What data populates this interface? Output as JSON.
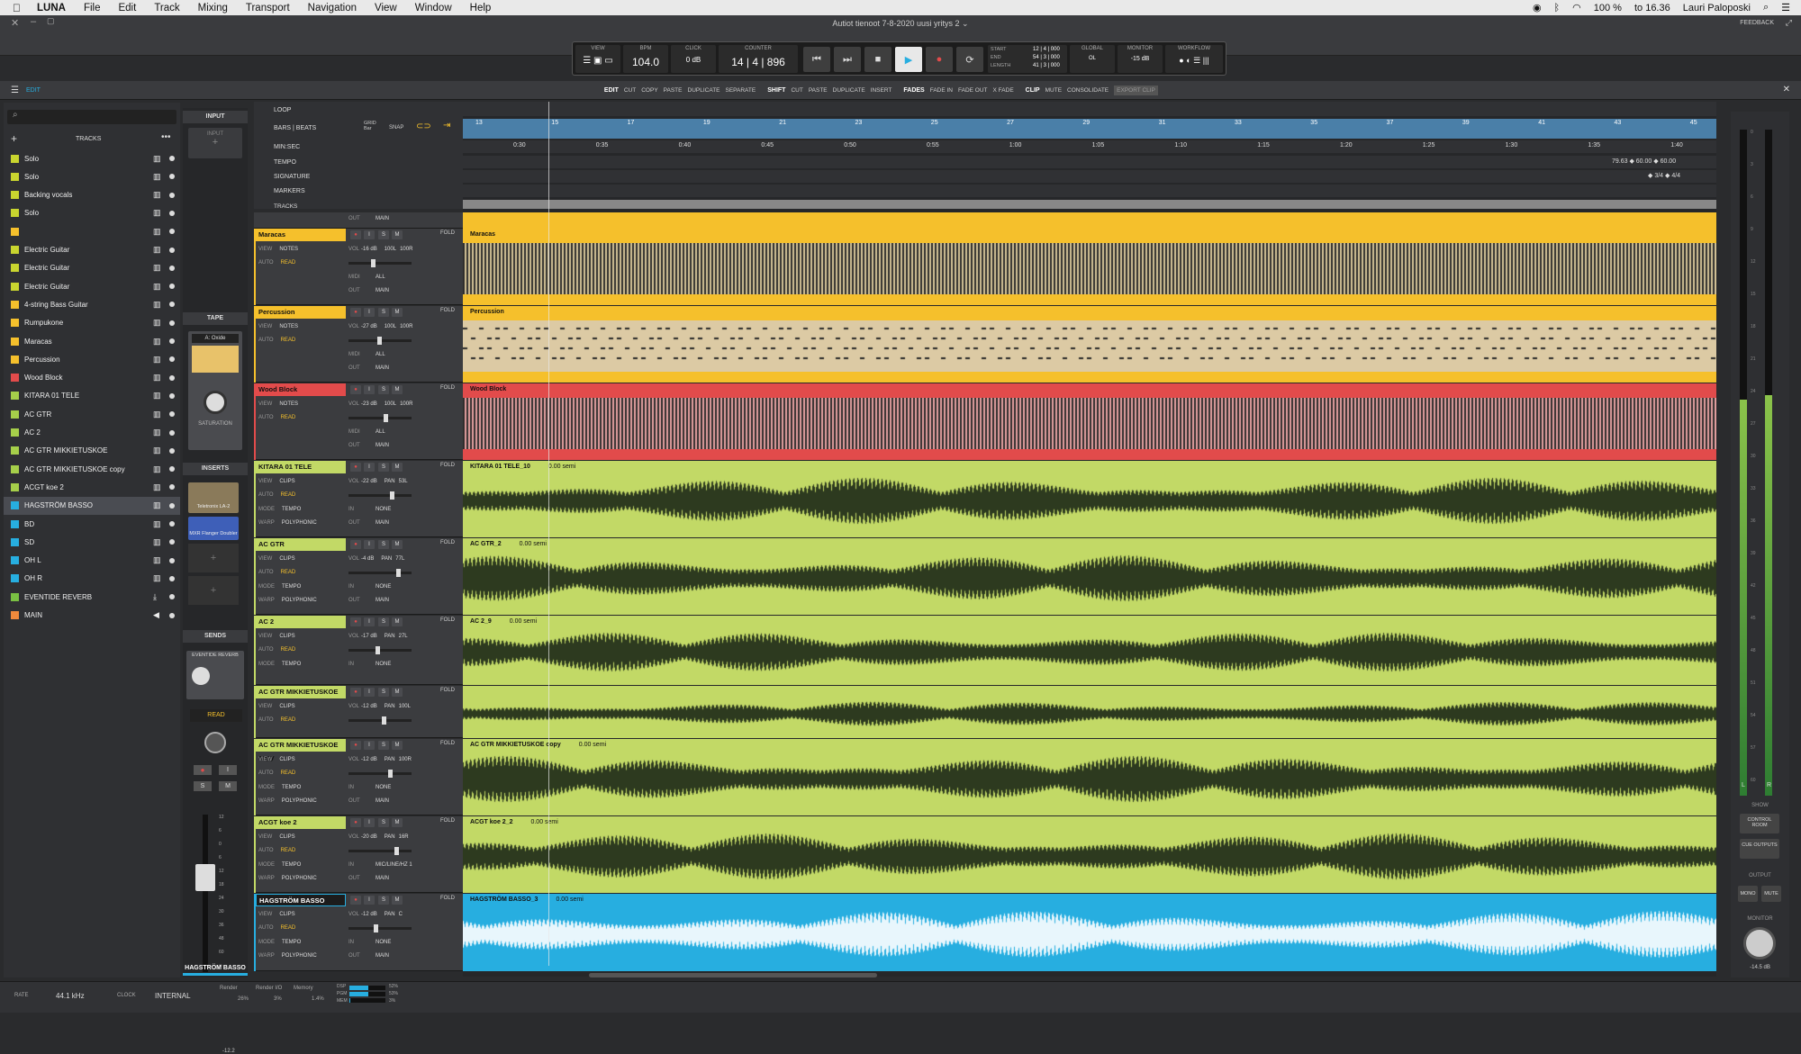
{
  "menubar": {
    "app": "LUNA",
    "items": [
      "File",
      "Edit",
      "Track",
      "Mixing",
      "Transport",
      "Navigation",
      "View",
      "Window",
      "Help"
    ],
    "battery": "100 %",
    "clock": "to 16.36",
    "user": "Lauri Paloposki"
  },
  "window": {
    "title": "Autiot tienoot 7-8-2020 uusi yritys 2",
    "feedback": "FEEDBACK",
    "edit_tab": "EDIT"
  },
  "transport": {
    "view_label": "VIEW",
    "bpm_label": "BPM",
    "bpm": "104.0",
    "click_label": "CLICK",
    "click_value": "0 dB",
    "counter_label": "COUNTER",
    "counter": "14 | 4 | 896",
    "start_label": "START",
    "end_label": "END",
    "length_label": "LENGTH",
    "start": "12 | 4 | 000",
    "end": "54 | 3 | 000",
    "length": "41 | 3 | 000",
    "global_label": "GLOBAL",
    "monitor_label": "MONITOR",
    "monitor_value": "-15 dB",
    "workflow_label": "WORKFLOW",
    "ol": "OL"
  },
  "toolbar": {
    "edit": "EDIT",
    "cut": "CUT",
    "copy": "COPY",
    "paste": "PASTE",
    "duplicate": "DUPLICATE",
    "separate": "SEPARATE",
    "shift": "SHIFT",
    "shift_cut": "CUT",
    "shift_paste": "PASTE",
    "shift_duplicate": "DUPLICATE",
    "insert": "INSERT",
    "fades": "FADES",
    "fade_in": "FADE IN",
    "fade_out": "FADE OUT",
    "x_fade": "X FADE",
    "clip": "CLIP",
    "mute": "MUTE",
    "consolidate": "CONSOLIDATE",
    "export_clip": "EXPORT CLIP"
  },
  "tracks_panel": {
    "title": "TRACKS",
    "items": [
      {
        "name": "Solo",
        "color": "#c9d52f",
        "icon": "piano-icon"
      },
      {
        "name": "Solo",
        "color": "#c9d52f",
        "icon": "piano-icon"
      },
      {
        "name": "Backing vocals",
        "color": "#c9d52f",
        "icon": "piano-icon"
      },
      {
        "name": "Solo",
        "color": "#c9d52f",
        "icon": "piano-icon"
      },
      {
        "name": "",
        "color": "#f5c02c",
        "icon": "piano-icon"
      },
      {
        "name": "Electric Guitar",
        "color": "#c9d52f",
        "icon": "piano-icon"
      },
      {
        "name": "Electric Guitar",
        "color": "#c9d52f",
        "icon": "piano-icon"
      },
      {
        "name": "Electric Guitar",
        "color": "#c9d52f",
        "icon": "piano-icon"
      },
      {
        "name": "4-string Bass Guitar",
        "color": "#f5c02c",
        "icon": "piano-icon"
      },
      {
        "name": "Rumpukone",
        "color": "#f5c02c",
        "icon": "piano-icon"
      },
      {
        "name": "Maracas",
        "color": "#f5c02c",
        "icon": "piano-icon"
      },
      {
        "name": "Percussion",
        "color": "#f5c02c",
        "icon": "piano-icon"
      },
      {
        "name": "Wood Block",
        "color": "#e24b4b",
        "icon": "piano-icon"
      },
      {
        "name": "KITARA 01 TELE",
        "color": "#a6cf4a",
        "icon": "waveform-icon"
      },
      {
        "name": "AC GTR",
        "color": "#a6cf4a",
        "icon": "waveform-icon"
      },
      {
        "name": "AC 2",
        "color": "#a6cf4a",
        "icon": "waveform-icon"
      },
      {
        "name": "AC GTR MIKKIETUSKOE",
        "color": "#a6cf4a",
        "icon": "waveform-icon"
      },
      {
        "name": "AC GTR MIKKIETUSKOE copy",
        "color": "#a6cf4a",
        "icon": "waveform-icon"
      },
      {
        "name": "ACGT koe 2",
        "color": "#a6cf4a",
        "icon": "waveform-icon"
      },
      {
        "name": "HAGSTRÖM BASSO",
        "color": "#27aee0",
        "icon": "waveform-icon"
      },
      {
        "name": "BD",
        "color": "#27aee0",
        "icon": "waveform-icon"
      },
      {
        "name": "SD",
        "color": "#27aee0",
        "icon": "waveform-icon"
      },
      {
        "name": "OH L",
        "color": "#27aee0",
        "icon": "waveform-icon"
      },
      {
        "name": "OH R",
        "color": "#27aee0",
        "icon": "waveform-icon"
      },
      {
        "name": "EVENTIDE REVERB",
        "color": "#7ac043",
        "icon": "bus-icon"
      },
      {
        "name": "MAIN",
        "color": "#f08a3c",
        "icon": "speaker-icon"
      }
    ]
  },
  "strip": {
    "input": "INPUT",
    "input_btn": "INPUT",
    "tape": "TAPE",
    "tape_type": "A: Oxide",
    "saturation": "SATURATION",
    "inserts": "INSERTS",
    "insert1": "Teletronix LA-2",
    "insert2": "MXR Flanger Doubler",
    "sends": "SENDS",
    "send1": "EVENTIDE REVERB",
    "read": "READ",
    "track_name": "HAGSTRÖM BASSO",
    "fader_val": "-12.2",
    "fader_scale": [
      "12",
      "6",
      "0",
      "6",
      "12",
      "18",
      "24",
      "30",
      "36",
      "48",
      "60",
      "∞"
    ]
  },
  "rulers": {
    "loop": "LOOP",
    "bars_beats": "BARS | BEATS",
    "grid": "GRID",
    "grid_val": "Bar",
    "snap": "SNAP",
    "minsec": "MIN:SEC",
    "tempo": "TEMPO",
    "signature": "SIGNATURE",
    "markers": "MARKERS",
    "tracks": "TRACKS",
    "bars": [
      "13",
      "15",
      "17",
      "19",
      "21",
      "23",
      "25",
      "27",
      "29",
      "31",
      "33",
      "35",
      "37",
      "39",
      "41",
      "43",
      "45"
    ],
    "times": [
      "0:30",
      "0:35",
      "0:40",
      "0:45",
      "0:50",
      "0:55",
      "1:00",
      "1:05",
      "1:10",
      "1:15",
      "1:20",
      "1:25",
      "1:30",
      "1:35",
      "1:40"
    ],
    "tempo_vals": "79.63 ◆ 60.00 ◆ 60.00",
    "sig_vals": "◆ 3/4  ◆ 4/4"
  },
  "track_headers": [
    {
      "name": "Maracas",
      "color": "#f5c02c",
      "view": "NOTES",
      "auto": "READ",
      "vol": "-16 dB",
      "pan": "100L",
      "pan2": "100R",
      "rows": [
        [
          "MIDI",
          "ALL"
        ],
        [
          "OUT",
          "MAIN"
        ]
      ],
      "clip": "Maracas",
      "type": "midi",
      "h": 85
    },
    {
      "name": "Percussion",
      "color": "#f5c02c",
      "view": "NOTES",
      "auto": "READ",
      "vol": "-27 dB",
      "pan": "100L",
      "pan2": "100R",
      "rows": [
        [
          "MIDI",
          "ALL"
        ],
        [
          "OUT",
          "MAIN"
        ]
      ],
      "clip": "Percussion",
      "type": "midi2",
      "h": 85
    },
    {
      "name": "Wood Block",
      "color": "#e24b4b",
      "view": "NOTES",
      "auto": "READ",
      "vol": "-23 dB",
      "pan": "100L",
      "pan2": "100R",
      "rows": [
        [
          "MIDI",
          "ALL"
        ],
        [
          "OUT",
          "MAIN"
        ]
      ],
      "clip": "Wood Block",
      "type": "midi",
      "h": 85
    },
    {
      "name": "KITARA 01 TELE",
      "color": "#c2d966",
      "view": "CLIPS",
      "auto": "READ",
      "vol": "-22 dB",
      "pan": "PAN",
      "pan2": "53L",
      "rows": [
        [
          "MODE",
          "TEMPO",
          "IN",
          "NONE"
        ],
        [
          "WARP",
          "POLYPHONIC",
          "OUT",
          "MAIN"
        ]
      ],
      "clip": "KITARA 01 TELE_10",
      "semi": "0.00 semi",
      "type": "audio",
      "h": 85
    },
    {
      "name": "AC GTR",
      "color": "#c2d966",
      "view": "CLIPS",
      "auto": "READ",
      "vol": "-4 dB",
      "pan": "PAN",
      "pan2": "77L",
      "rows": [
        [
          "MODE",
          "TEMPO",
          "IN",
          "NONE"
        ],
        [
          "WARP",
          "POLYPHONIC",
          "OUT",
          "MAIN"
        ]
      ],
      "clip": "AC GTR_2",
      "semi": "0.00 semi",
      "type": "audio",
      "h": 85
    },
    {
      "name": "AC 2",
      "color": "#c2d966",
      "view": "CLIPS",
      "auto": "READ",
      "vol": "-17 dB",
      "pan": "PAN",
      "pan2": "27L",
      "rows": [
        [
          "MODE",
          "TEMPO",
          "IN",
          "NONE"
        ]
      ],
      "clip": "AC 2_9",
      "semi": "0.00 semi",
      "type": "audio",
      "h": 77
    },
    {
      "name": "AC GTR MIKKIETUSKOE",
      "color": "#c2d966",
      "view": "CLIPS",
      "auto": "READ",
      "vol": "-12 dB",
      "pan": "PAN",
      "pan2": "100L",
      "rows": [],
      "clip": "",
      "semi": "",
      "type": "audio",
      "h": 58
    },
    {
      "name": "AC GTR MIKKIETUSKOE copy",
      "color": "#c2d966",
      "view": "CLIPS",
      "auto": "READ",
      "vol": "-12 dB",
      "pan": "PAN",
      "pan2": "100R",
      "rows": [
        [
          "MODE",
          "TEMPO",
          "IN",
          "NONE"
        ],
        [
          "WARP",
          "POLYPHONIC",
          "OUT",
          "MAIN"
        ]
      ],
      "clip": "AC GTR MIKKIETUSKOE copy",
      "semi": "0.00 semi",
      "type": "audio",
      "h": 85
    },
    {
      "name": "ACGT koe 2",
      "color": "#c2d966",
      "view": "CLIPS",
      "auto": "READ",
      "vol": "-20 dB",
      "pan": "PAN",
      "pan2": "16R",
      "rows": [
        [
          "MODE",
          "TEMPO",
          "IN",
          "MIC/LINE/HZ 1"
        ],
        [
          "WARP",
          "POLYPHONIC",
          "OUT",
          "MAIN"
        ]
      ],
      "clip": "ACGT koe 2_2",
      "semi": "0.00 semi",
      "type": "audio",
      "h": 85
    },
    {
      "name": "HAGSTRÖM BASSO",
      "color": "#27aee0",
      "view": "CLIPS",
      "auto": "READ",
      "vol": "-12 dB",
      "pan": "PAN",
      "pan2": "C",
      "rows": [
        [
          "MODE",
          "TEMPO",
          "IN",
          "NONE"
        ],
        [
          "WARP",
          "POLYPHONIC",
          "OUT",
          "MAIN"
        ]
      ],
      "clip": "HAGSTRÖM BASSO_3",
      "semi": "0.00 semi",
      "type": "bass",
      "h": 86
    }
  ],
  "track_btns": {
    "fold": "FOLD",
    "fit": "FIT",
    "i": "I",
    "s": "S",
    "m": "M",
    "view": "VIEW",
    "auto": "AUTO",
    "vol": "VOL",
    "out": "OUT",
    "main": "MAIN"
  },
  "meter": {
    "scale": [
      "0",
      "3",
      "6",
      "9",
      "12",
      "15",
      "18",
      "21",
      "24",
      "27",
      "30",
      "33",
      "36",
      "39",
      "42",
      "45",
      "48",
      "51",
      "54",
      "57",
      "60"
    ],
    "l": "L",
    "r": "R",
    "show": "SHOW",
    "control_room": "CONTROL ROOM",
    "cue_outputs": "CUE OUTPUTS",
    "output": "OUTPUT",
    "mono": "MONO",
    "mute": "MUTE",
    "monitor": "MONITOR",
    "monitor_val": "-14.5 dB"
  },
  "status": {
    "rate_label": "RATE",
    "rate": "44.1 kHz",
    "clock_label": "CLOCK",
    "clock": "INTERNAL",
    "render": "Render",
    "render_val": "26%",
    "renderio": "Render I/O",
    "renderio_val": "3%",
    "memory": "Memory",
    "memory_val": "1.4%",
    "dsp": "DSP",
    "pgm": "PGM",
    "mem": "MEM",
    "p1": "52%",
    "p2": "53%",
    "p3": "3%"
  }
}
